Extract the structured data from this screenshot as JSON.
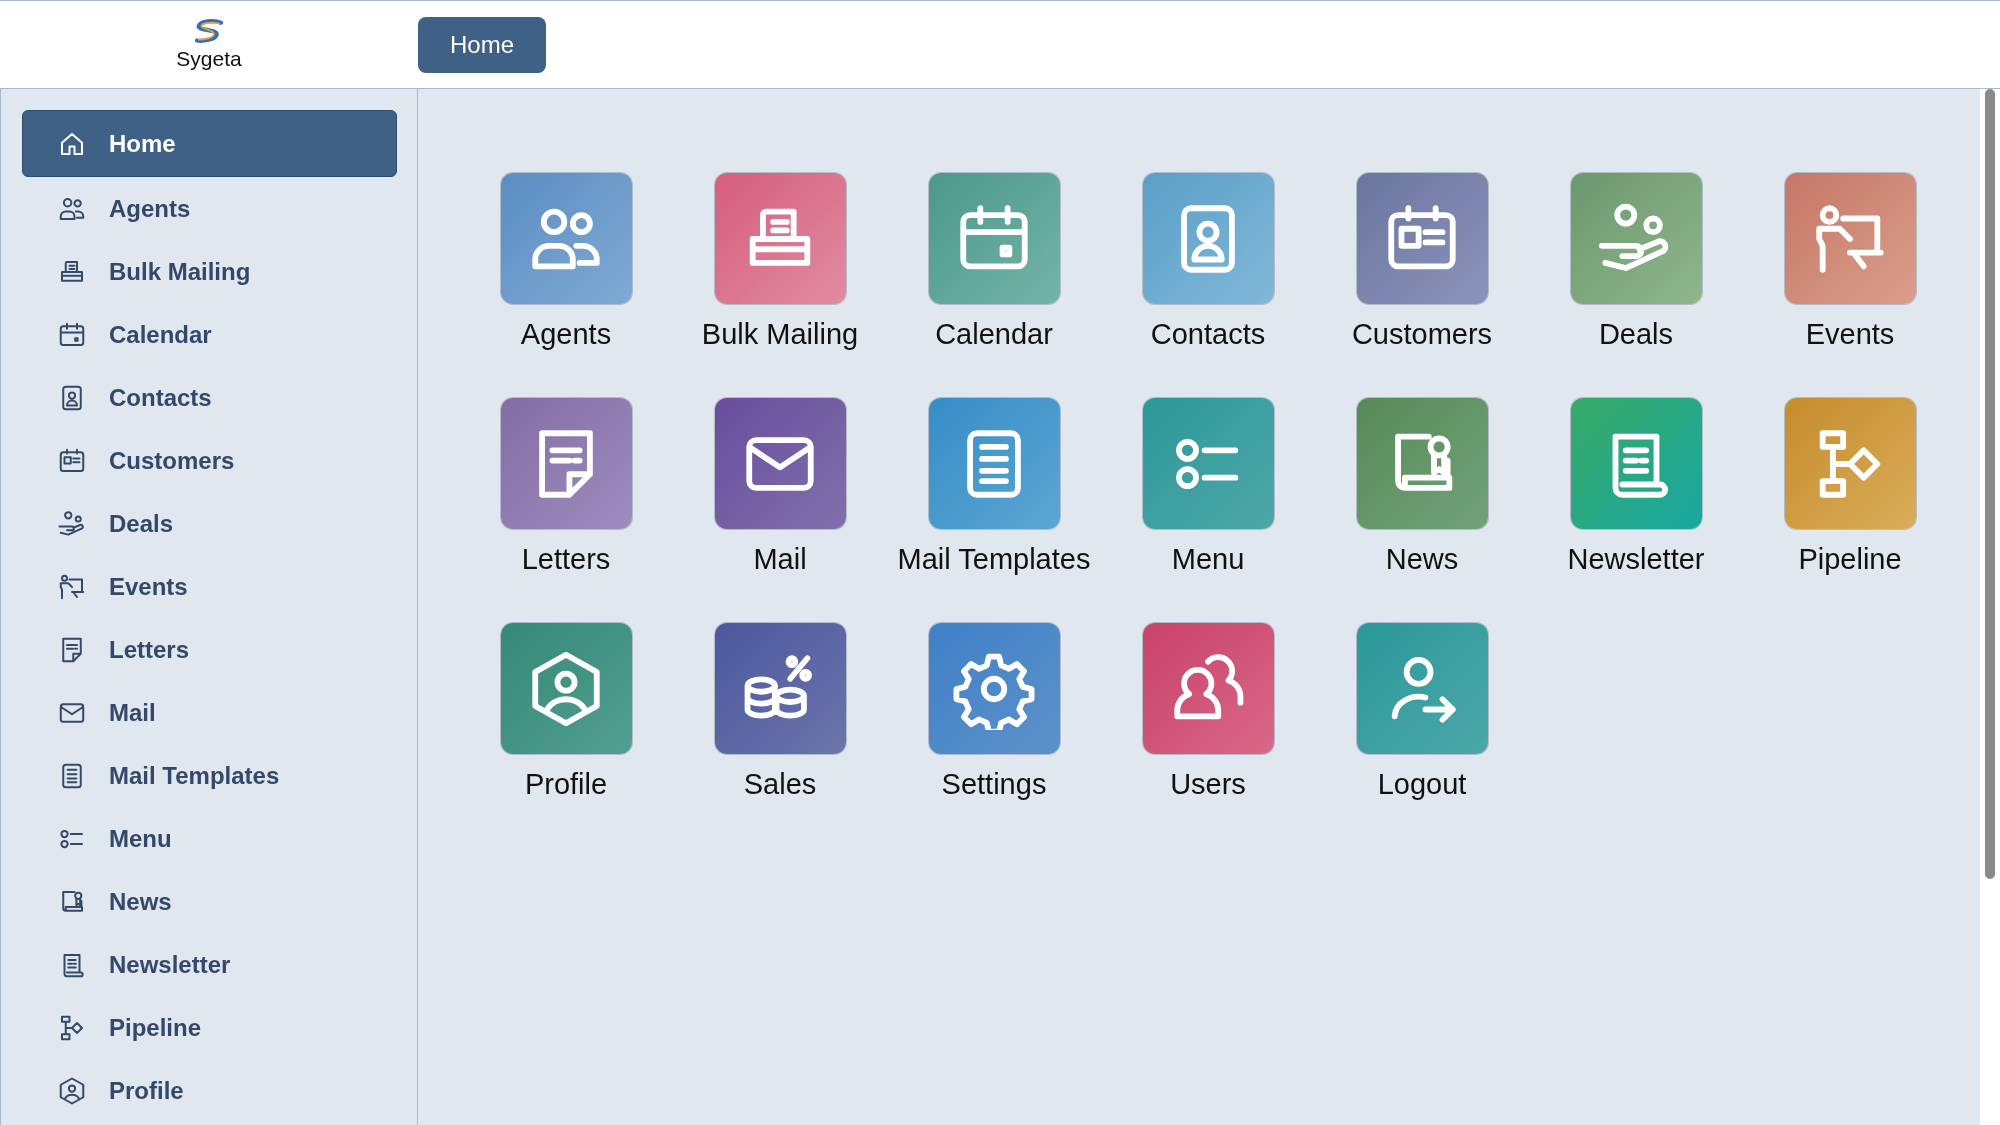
{
  "brand": {
    "name": "Sygeta"
  },
  "header": {
    "tabs": [
      {
        "label": "Home",
        "selected": true
      }
    ]
  },
  "sidebar": {
    "items": [
      {
        "label": "Home",
        "selected": true
      },
      {
        "label": "Agents",
        "selected": false
      },
      {
        "label": "Bulk Mailing",
        "selected": false
      },
      {
        "label": "Calendar",
        "selected": false
      },
      {
        "label": "Contacts",
        "selected": false
      },
      {
        "label": "Customers",
        "selected": false
      },
      {
        "label": "Deals",
        "selected": false
      },
      {
        "label": "Events",
        "selected": false
      },
      {
        "label": "Letters",
        "selected": false
      },
      {
        "label": "Mail",
        "selected": false
      },
      {
        "label": "Mail Templates",
        "selected": false
      },
      {
        "label": "Menu",
        "selected": false
      },
      {
        "label": "News",
        "selected": false
      },
      {
        "label": "Newsletter",
        "selected": false
      },
      {
        "label": "Pipeline",
        "selected": false
      },
      {
        "label": "Profile",
        "selected": false
      }
    ]
  },
  "tiles": [
    {
      "label": "Agents"
    },
    {
      "label": "Bulk Mailing"
    },
    {
      "label": "Calendar"
    },
    {
      "label": "Contacts"
    },
    {
      "label": "Customers"
    },
    {
      "label": "Deals"
    },
    {
      "label": "Events"
    },
    {
      "label": "Letters"
    },
    {
      "label": "Mail"
    },
    {
      "label": "Mail Templates"
    },
    {
      "label": "Menu"
    },
    {
      "label": "News"
    },
    {
      "label": "Newsletter"
    },
    {
      "label": "Pipeline"
    },
    {
      "label": "Profile"
    },
    {
      "label": "Sales"
    },
    {
      "label": "Settings"
    },
    {
      "label": "Users"
    },
    {
      "label": "Logout"
    }
  ]
}
